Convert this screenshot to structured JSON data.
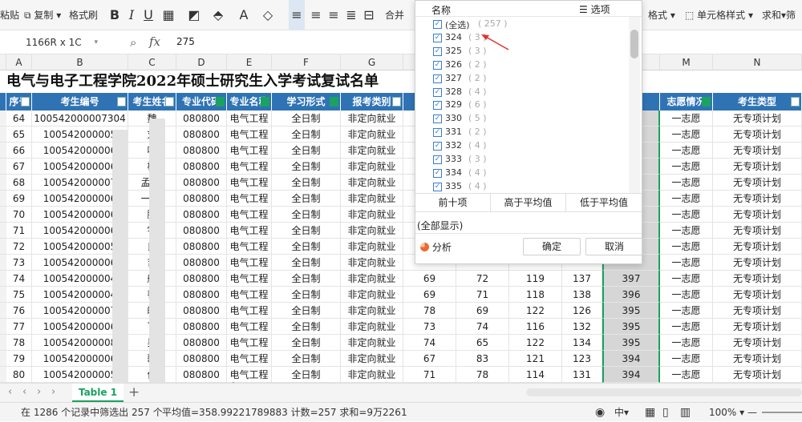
{
  "toolbar": {
    "paste": "粘贴",
    "copy": "复制",
    "format_painter": "格式刷",
    "merge": "合并",
    "format": "格式",
    "cell_format": "单元格样式",
    "sum": "求和",
    "filter": "筛"
  },
  "formula_bar": {
    "namebox": "1166R x 1C",
    "fx": "fx",
    "value": "275"
  },
  "columns": [
    "A",
    "B",
    "C",
    "D",
    "E",
    "F",
    "G",
    "M",
    "N"
  ],
  "title": "电气与电子工程学院2022年硕士研究生入学考试复试名单",
  "headers": [
    "序号",
    "考生编号",
    "考生姓名",
    "专业代码",
    "专业名称",
    "学习形式",
    "报考类别",
    "志愿情况",
    "考生类型"
  ],
  "rows": [
    {
      "seq": "64",
      "id": "100542000007304",
      "name": "魏",
      "code": "080800",
      "major": "电气工程",
      "mode": "全日制",
      "cat": "非定向就业",
      "s1": "",
      "s2": "",
      "s3": "",
      "s4": "",
      "total": "",
      "vol": "一志愿",
      "type": "无专项计划"
    },
    {
      "seq": "65",
      "id": "100542000005",
      "name": "刘",
      "code": "080800",
      "major": "电气工程",
      "mode": "全日制",
      "cat": "非定向就业",
      "s1": "",
      "s2": "",
      "s3": "",
      "s4": "",
      "total": "",
      "vol": "一志愿",
      "type": "无专项计划"
    },
    {
      "seq": "66",
      "id": "100542000006",
      "name": "叶",
      "code": "080800",
      "major": "电气工程",
      "mode": "全日制",
      "cat": "非定向就业",
      "s1": "",
      "s2": "",
      "s3": "",
      "s4": "",
      "total": "",
      "vol": "一志愿",
      "type": "无专项计划"
    },
    {
      "seq": "67",
      "id": "100542000006",
      "name": "杨",
      "code": "080800",
      "major": "电气工程",
      "mode": "全日制",
      "cat": "非定向就业",
      "s1": "",
      "s2": "",
      "s3": "",
      "s4": "",
      "total": "",
      "vol": "一志愿",
      "type": "无专项计划"
    },
    {
      "seq": "68",
      "id": "100542000007",
      "name": "孟 彤",
      "code": "080800",
      "major": "电气工程",
      "mode": "全日制",
      "cat": "非定向就业",
      "s1": "",
      "s2": "",
      "s3": "",
      "s4": "",
      "total": "",
      "vol": "一志愿",
      "type": "无专项计划"
    },
    {
      "seq": "69",
      "id": "100542000006",
      "name": "一 跃",
      "code": "080800",
      "major": "电气工程",
      "mode": "全日制",
      "cat": "非定向就业",
      "s1": "",
      "s2": "",
      "s3": "",
      "s4": "",
      "total": "",
      "vol": "一志愿",
      "type": "无专项计划"
    },
    {
      "seq": "70",
      "id": "100542000006",
      "name": "鹏",
      "code": "080800",
      "major": "电气工程",
      "mode": "全日制",
      "cat": "非定向就业",
      "s1": "",
      "s2": "",
      "s3": "",
      "s4": "",
      "total": "",
      "vol": "一志愿",
      "type": "无专项计划"
    },
    {
      "seq": "71",
      "id": "100542000006",
      "name": "宇",
      "code": "080800",
      "major": "电气工程",
      "mode": "全日制",
      "cat": "非定向就业",
      "s1": "",
      "s2": "",
      "s3": "",
      "s4": "",
      "total": "",
      "vol": "一志愿",
      "type": "无专项计划"
    },
    {
      "seq": "72",
      "id": "100542000005",
      "name": "良",
      "code": "080800",
      "major": "电气工程",
      "mode": "全日制",
      "cat": "非定向就业",
      "s1": "",
      "s2": "",
      "s3": "",
      "s4": "",
      "total": "",
      "vol": "一志愿",
      "type": "无专项计划"
    },
    {
      "seq": "73",
      "id": "100542000006",
      "name": "吉",
      "code": "080800",
      "major": "电气工程",
      "mode": "全日制",
      "cat": "非定向就业",
      "s1": "",
      "s2": "",
      "s3": "",
      "s4": "",
      "total": "",
      "vol": "一志愿",
      "type": "无专项计划"
    },
    {
      "seq": "74",
      "id": "100542000004",
      "name": "航",
      "code": "080800",
      "major": "电气工程",
      "mode": "全日制",
      "cat": "非定向就业",
      "s1": "69",
      "s2": "72",
      "s3": "119",
      "s4": "137",
      "total": "397",
      "vol": "一志愿",
      "type": "无专项计划"
    },
    {
      "seq": "75",
      "id": "100542000004",
      "name": "韬",
      "code": "080800",
      "major": "电气工程",
      "mode": "全日制",
      "cat": "非定向就业",
      "s1": "69",
      "s2": "71",
      "s3": "118",
      "s4": "138",
      "total": "396",
      "vol": "一志愿",
      "type": "无专项计划"
    },
    {
      "seq": "76",
      "id": "100542000007",
      "name": "皓",
      "code": "080800",
      "major": "电气工程",
      "mode": "全日制",
      "cat": "非定向就业",
      "s1": "78",
      "s2": "69",
      "s3": "122",
      "s4": "126",
      "total": "395",
      "vol": "一志愿",
      "type": "无专项计划"
    },
    {
      "seq": "77",
      "id": "100542000006",
      "name": "飞",
      "code": "080800",
      "major": "电气工程",
      "mode": "全日制",
      "cat": "非定向就业",
      "s1": "73",
      "s2": "74",
      "s3": "116",
      "s4": "132",
      "total": "395",
      "vol": "一志愿",
      "type": "无专项计划"
    },
    {
      "seq": "78",
      "id": "100542000008",
      "name": "昊",
      "code": "080800",
      "major": "电气工程",
      "mode": "全日制",
      "cat": "非定向就业",
      "s1": "74",
      "s2": "65",
      "s3": "122",
      "s4": "134",
      "total": "395",
      "vol": "一志愿",
      "type": "无专项计划"
    },
    {
      "seq": "79",
      "id": "100542000006",
      "name": "歌",
      "code": "080800",
      "major": "电气工程",
      "mode": "全日制",
      "cat": "非定向就业",
      "s1": "67",
      "s2": "83",
      "s3": "121",
      "s4": "123",
      "total": "394",
      "vol": "一志愿",
      "type": "无专项计划"
    },
    {
      "seq": "80",
      "id": "100542000005",
      "name": "伟",
      "code": "080800",
      "major": "电气工程",
      "mode": "全日制",
      "cat": "非定向就业",
      "s1": "71",
      "s2": "78",
      "s3": "114",
      "s4": "131",
      "total": "394",
      "vol": "一志愿",
      "type": "无专项计划"
    }
  ],
  "filter_panel": {
    "header": "名称",
    "options_label": "选项",
    "items": [
      {
        "label": "(全选)",
        "count": "( 257 )"
      },
      {
        "label": "324",
        "count": "( 3 )"
      },
      {
        "label": "325",
        "count": "( 3 )"
      },
      {
        "label": "326",
        "count": "( 2 )"
      },
      {
        "label": "327",
        "count": "( 2 )"
      },
      {
        "label": "328",
        "count": "( 4 )"
      },
      {
        "label": "329",
        "count": "( 6 )"
      },
      {
        "label": "330",
        "count": "( 5 )"
      },
      {
        "label": "331",
        "count": "( 2 )"
      },
      {
        "label": "332",
        "count": "( 4 )"
      },
      {
        "label": "333",
        "count": "( 3 )"
      },
      {
        "label": "334",
        "count": "( 4 )"
      },
      {
        "label": "335",
        "count": "( 4 )"
      }
    ],
    "top10": "前十项",
    "above_avg": "高于平均值",
    "below_avg": "低于平均值",
    "show_all": "(全部显示)",
    "analyze": "分析",
    "ok": "确定",
    "cancel": "取消"
  },
  "sheet_tab": "Table 1",
  "status": {
    "filter_info": "在 1286 个记录中筛选出 257 个",
    "stats": "平均值=358.99221789883 计数=257 求和=9万2261",
    "zoom": "100%"
  },
  "colors": {
    "header_blue": "#2f73b5",
    "annotation_red": "#e0342f",
    "check_blue": "#3a7bd5"
  }
}
